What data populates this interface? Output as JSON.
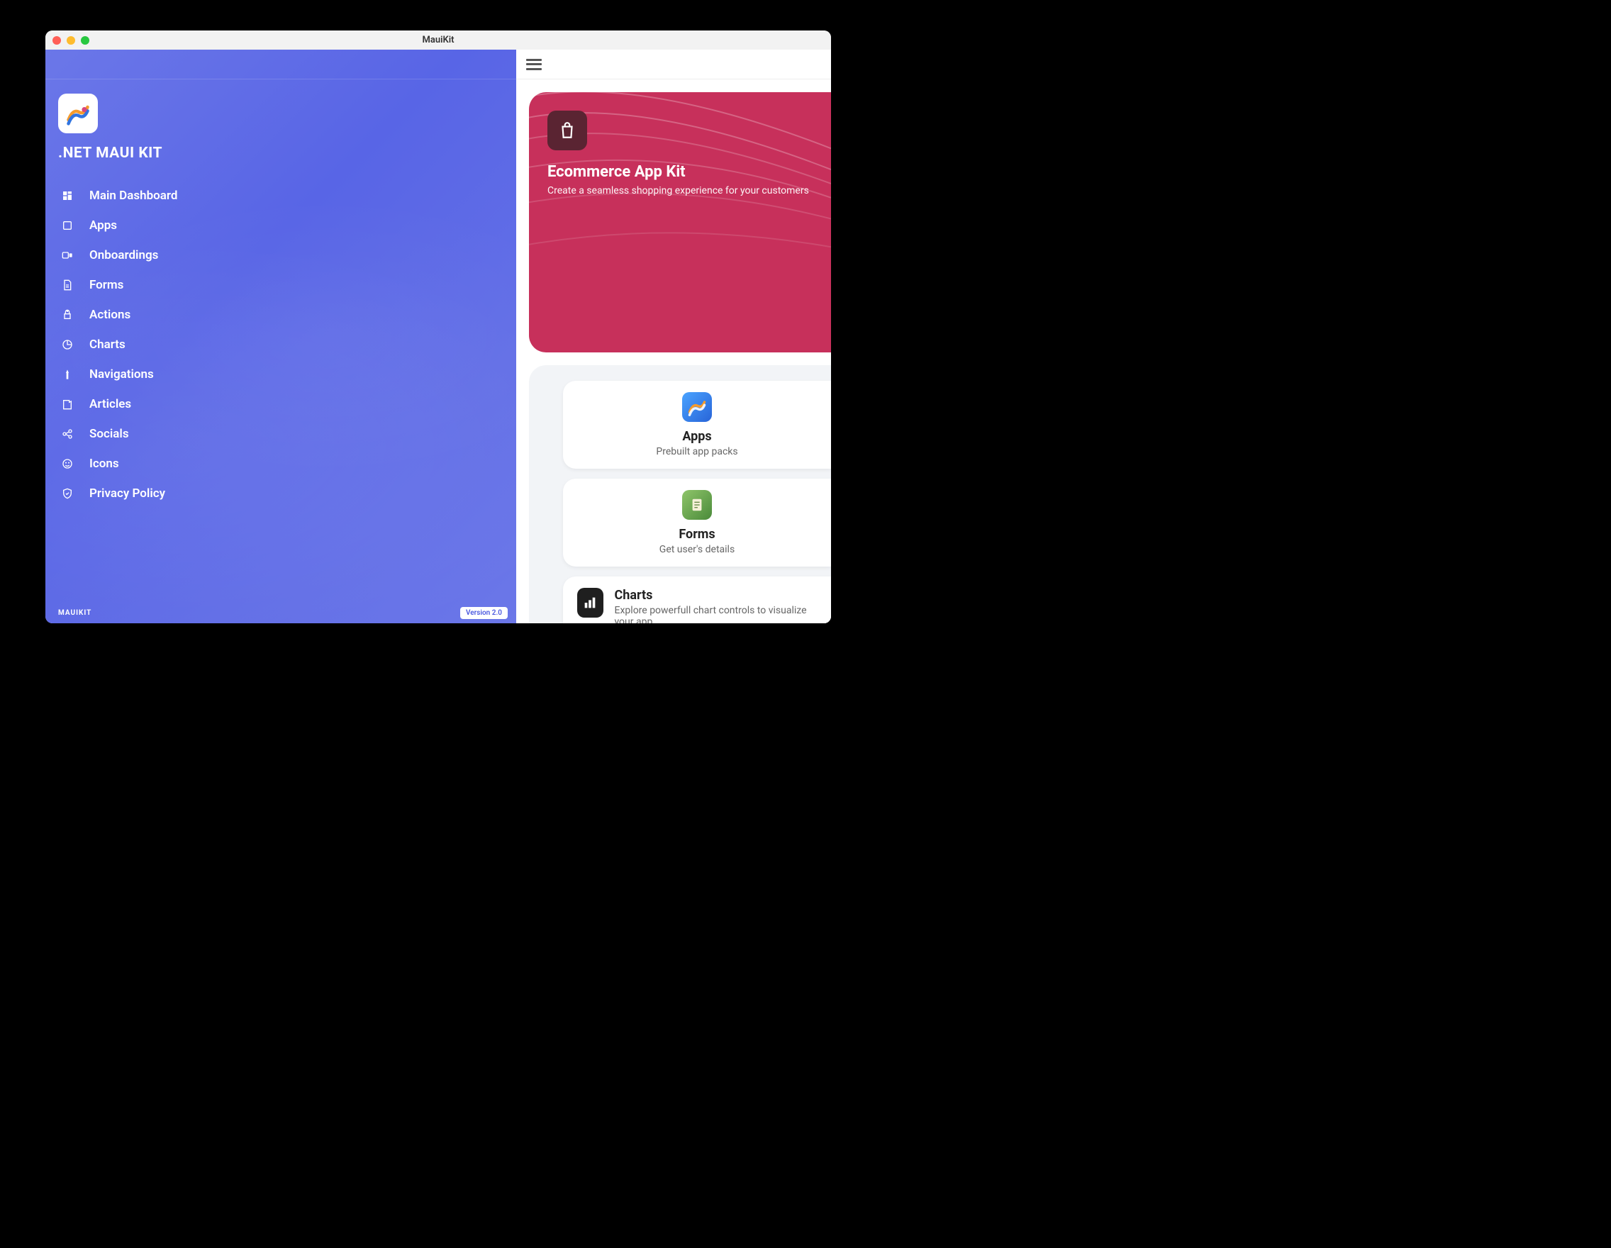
{
  "window": {
    "title": "MauiKit"
  },
  "sidebar": {
    "title": ".NET MAUI KIT",
    "footer_brand": "MAUIKIT",
    "version_label": "Version 2.0",
    "nav": [
      {
        "label": "Main Dashboard",
        "icon": "dashboard"
      },
      {
        "label": "Apps",
        "icon": "apps"
      },
      {
        "label": "Onboardings",
        "icon": "onboarding"
      },
      {
        "label": "Forms",
        "icon": "forms"
      },
      {
        "label": "Actions",
        "icon": "actions"
      },
      {
        "label": "Charts",
        "icon": "charts"
      },
      {
        "label": "Navigations",
        "icon": "nav"
      },
      {
        "label": "Articles",
        "icon": "articles"
      },
      {
        "label": "Socials",
        "icon": "socials"
      },
      {
        "label": "Icons",
        "icon": "icons"
      },
      {
        "label": "Privacy Policy",
        "icon": "privacy"
      }
    ]
  },
  "hero": {
    "title": "Ecommerce App Kit",
    "subtitle": "Create a seamless shopping experience for your customers"
  },
  "cards": [
    {
      "title": "Apps",
      "subtitle": "Prebuilt app packs",
      "layout": "center",
      "icon": "apps-color"
    },
    {
      "title": "Forms",
      "subtitle": "Get user's details",
      "layout": "center",
      "icon": "forms-color"
    },
    {
      "title": "Charts",
      "subtitle": "Explore powerfull chart controls to visualize your app",
      "layout": "row",
      "icon": "charts-color"
    }
  ]
}
